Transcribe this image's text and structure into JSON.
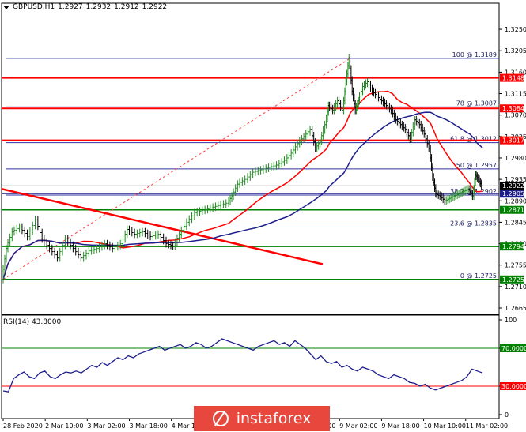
{
  "title": {
    "symbol": "GBPUSD,H1",
    "open": "1.2927",
    "high": "1.2932",
    "low": "1.2912",
    "close": "1.2922"
  },
  "colors": {
    "background": "#ffffff",
    "grid": "#000000",
    "fib_line": "#3030a0",
    "resistance": "#ff0000",
    "support": "#008000",
    "ma_red": "#ff0000",
    "ma_blue": "#1e1e8c",
    "trend": "#ff0000",
    "price": "#000000",
    "bull": "#1e8c1e",
    "rsi": "#1e1e8c",
    "rsi_70": "#008000",
    "rsi_30": "#ff0000"
  },
  "watermark": {
    "text": "instaforex",
    "icon": "instaforex-logo-icon"
  },
  "chart_data": [
    {
      "type": "line",
      "name": "price",
      "ylim": [
        1.2665,
        1.3275
      ],
      "y_ticks": [
        "1.3250",
        "1.3205",
        "1.3160",
        "1.3115",
        "1.3070",
        "1.3025",
        "1.2980",
        "1.2935",
        "1.2890",
        "1.2845",
        "1.2800",
        "1.2755",
        "1.2710",
        "1.2665"
      ],
      "x_labels": [
        "28 Feb 2020",
        "2 Mar 10:00",
        "3 Mar 02:00",
        "3 Mar 18:00",
        "4 Mar 10:00",
        "5 Mar 02:00",
        "5 Mar 18:00",
        "6 Mar 10:00",
        "9 Mar 02:00",
        "9 Mar 18:00",
        "10 Mar 10:00",
        "11 Mar 02:00"
      ],
      "fib_levels": [
        {
          "label": "100 @ 1.3189",
          "value": 1.3189
        },
        {
          "label": "78 @ 1.3087",
          "value": 1.3087
        },
        {
          "label": "61.8 @ 1.3012",
          "value": 1.3012
        },
        {
          "label": "50 @ 1.2957",
          "value": 1.2957
        },
        {
          "label": "38.2 @ 1.2902",
          "value": 1.2902
        },
        {
          "label": "23.6 @ 1.2835",
          "value": 1.2835
        },
        {
          "label": "0 @ 1.2725",
          "value": 1.2725
        }
      ],
      "resistance_levels": [
        {
          "label": "1.3148",
          "value": 1.3148
        },
        {
          "label": "1.3084",
          "value": 1.3084
        },
        {
          "label": "1.3017",
          "value": 1.3017
        }
      ],
      "support_levels": [
        {
          "label": "1.2871",
          "value": 1.2871
        },
        {
          "label": "1.2794",
          "value": 1.2794
        },
        {
          "label": "1.2725",
          "value": 1.2725
        }
      ],
      "price_marker": {
        "label": "1.2922",
        "value": 1.2922
      },
      "level_marker": {
        "label": "1.2905",
        "value": 1.2905
      },
      "price_path": [
        [
          0,
          1.2725
        ],
        [
          6,
          1.279
        ],
        [
          14,
          1.2825
        ],
        [
          24,
          1.2835
        ],
        [
          34,
          1.2815
        ],
        [
          44,
          1.285
        ],
        [
          52,
          1.281
        ],
        [
          62,
          1.279
        ],
        [
          72,
          1.277
        ],
        [
          82,
          1.281
        ],
        [
          92,
          1.279
        ],
        [
          102,
          1.277
        ],
        [
          112,
          1.2785
        ],
        [
          122,
          1.279
        ],
        [
          132,
          1.28
        ],
        [
          142,
          1.279
        ],
        [
          152,
          1.28
        ],
        [
          160,
          1.283
        ],
        [
          170,
          1.282
        ],
        [
          180,
          1.2825
        ],
        [
          190,
          1.2815
        ],
        [
          200,
          1.282
        ],
        [
          210,
          1.28
        ],
        [
          218,
          1.2795
        ],
        [
          226,
          1.282
        ],
        [
          236,
          1.2845
        ],
        [
          246,
          1.2865
        ],
        [
          256,
          1.287
        ],
        [
          266,
          1.2875
        ],
        [
          276,
          1.288
        ],
        [
          286,
          1.2885
        ],
        [
          292,
          1.29
        ],
        [
          300,
          1.2925
        ],
        [
          310,
          1.2935
        ],
        [
          320,
          1.295
        ],
        [
          330,
          1.2955
        ],
        [
          340,
          1.296
        ],
        [
          350,
          1.2965
        ],
        [
          360,
          1.2975
        ],
        [
          368,
          1.299
        ],
        [
          376,
          1.301
        ],
        [
          384,
          1.3025
        ],
        [
          392,
          1.304
        ],
        [
          398,
          1.3
        ],
        [
          404,
          1.3015
        ],
        [
          410,
          1.305
        ],
        [
          414,
          1.309
        ],
        [
          420,
          1.308
        ],
        [
          426,
          1.31
        ],
        [
          432,
          1.308
        ],
        [
          436,
          1.314
        ],
        [
          440,
          1.319
        ],
        [
          444,
          1.312
        ],
        [
          448,
          1.308
        ],
        [
          452,
          1.31
        ],
        [
          458,
          1.313
        ],
        [
          464,
          1.314
        ],
        [
          470,
          1.312
        ],
        [
          476,
          1.311
        ],
        [
          482,
          1.31
        ],
        [
          488,
          1.309
        ],
        [
          494,
          1.308
        ],
        [
          500,
          1.306
        ],
        [
          506,
          1.305
        ],
        [
          512,
          1.304
        ],
        [
          518,
          1.302
        ],
        [
          524,
          1.306
        ],
        [
          530,
          1.305
        ],
        [
          536,
          1.303
        ],
        [
          542,
          1.3
        ],
        [
          546,
          1.294
        ],
        [
          550,
          1.2905
        ],
        [
          556,
          1.29
        ],
        [
          562,
          1.289
        ],
        [
          568,
          1.2895
        ],
        [
          574,
          1.29
        ],
        [
          580,
          1.2905
        ],
        [
          586,
          1.291
        ],
        [
          592,
          1.2915
        ],
        [
          597,
          1.29
        ],
        [
          600,
          1.2945
        ],
        [
          604,
          1.2935
        ],
        [
          608,
          1.2922
        ]
      ]
    },
    {
      "type": "line",
      "name": "RSI(14) 43.8000",
      "ylim": [
        0,
        100
      ],
      "y_ticks": [
        "100",
        "70.0000",
        "30.0000",
        "0"
      ],
      "levels": [
        70,
        30
      ],
      "values": [
        25,
        24,
        38,
        42,
        45,
        40,
        38,
        44,
        46,
        40,
        38,
        42,
        45,
        44,
        46,
        44,
        48,
        52,
        50,
        55,
        52,
        56,
        60,
        58,
        62,
        60,
        64,
        66,
        68,
        70,
        72,
        68,
        70,
        72,
        74,
        70,
        72,
        76,
        74,
        70,
        72,
        76,
        80,
        78,
        76,
        74,
        72,
        70,
        68,
        72,
        74,
        76,
        78,
        74,
        76,
        72,
        78,
        74,
        70,
        64,
        58,
        62,
        56,
        54,
        56,
        50,
        52,
        48,
        46,
        50,
        48,
        46,
        42,
        40,
        38,
        42,
        40,
        38,
        34,
        33,
        30,
        32,
        28,
        26,
        28,
        30,
        32,
        34,
        36,
        40,
        48,
        46,
        44
      ]
    }
  ]
}
